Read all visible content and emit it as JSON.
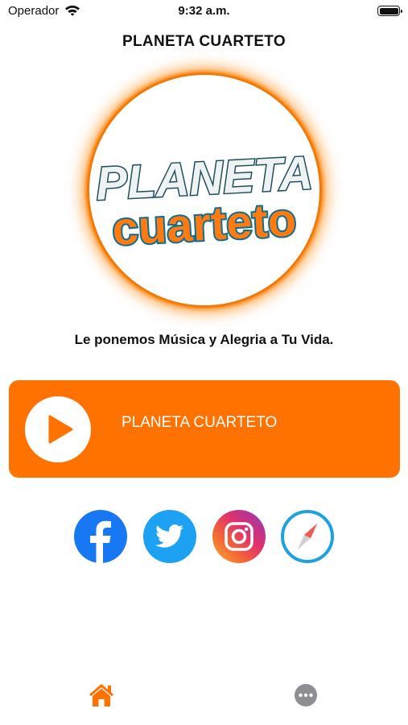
{
  "status_bar": {
    "carrier": "Operador",
    "time": "9:32 a.m."
  },
  "nav": {
    "title": "PLANETA CUARTETO"
  },
  "logo": {
    "line1": "PLANETA",
    "line2": "cuarteto"
  },
  "tagline": "Le ponemos Música y Alegria a Tu Vida.",
  "player": {
    "station": "PLANETA CUARTETO",
    "play_icon": "play-icon",
    "state": "stopped"
  },
  "social": [
    {
      "name": "facebook",
      "icon": "facebook-icon"
    },
    {
      "name": "twitter",
      "icon": "twitter-icon"
    },
    {
      "name": "instagram",
      "icon": "instagram-icon"
    },
    {
      "name": "website",
      "icon": "compass-icon"
    }
  ],
  "tabs": [
    {
      "name": "home",
      "icon": "home-icon",
      "selected": true
    },
    {
      "name": "more",
      "icon": "more-icon",
      "selected": false
    }
  ],
  "colors": {
    "accent": "#ff7200",
    "facebook": "#1877f2",
    "twitter": "#1da1f2",
    "compass": "#1ea1df",
    "tab_inactive": "#8e8e93"
  }
}
